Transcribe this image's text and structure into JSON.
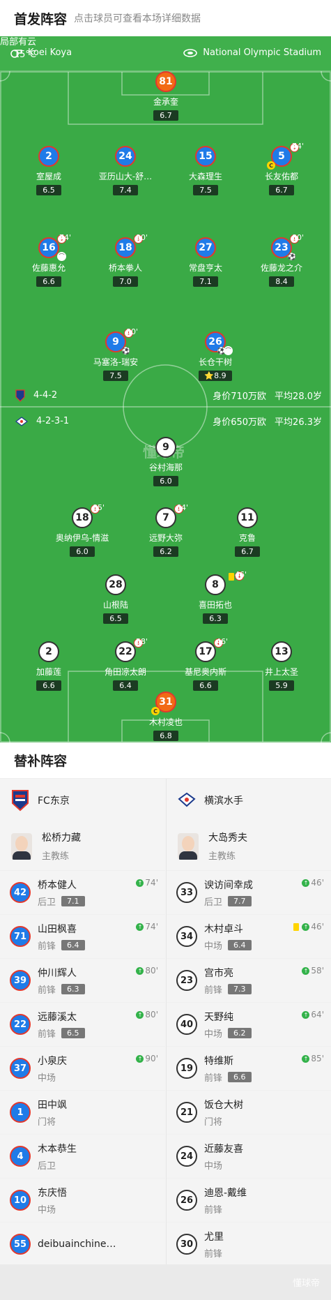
{
  "header": {
    "title": "首发阵容",
    "hint": "点击球员可查看本场详细数据"
  },
  "match": {
    "referee": "Koei Koya",
    "stadium": "National Olympic Stadium",
    "weather": "局部有云",
    "temperature": "15°C"
  },
  "home": {
    "formation": "4-4-2",
    "value": "身价710万欧",
    "age": "平均28.0岁",
    "players": [
      {
        "num": "81",
        "name": "金承奎",
        "rating": "6.7"
      },
      {
        "num": "2",
        "name": "室屋成",
        "rating": "6.5"
      },
      {
        "num": "24",
        "name": "亚历山大-舒…",
        "rating": "7.4"
      },
      {
        "num": "15",
        "name": "大森理生",
        "rating": "7.5"
      },
      {
        "num": "5",
        "name": "长友佑都",
        "rating": "6.7",
        "min": "74'"
      },
      {
        "num": "16",
        "name": "佐藤惠允",
        "rating": "6.6",
        "min": "74'"
      },
      {
        "num": "18",
        "name": "桥本拳人",
        "rating": "7.0",
        "min": "90'"
      },
      {
        "num": "27",
        "name": "常盘亨太",
        "rating": "7.1"
      },
      {
        "num": "23",
        "name": "佐藤龙之介",
        "rating": "8.4",
        "min": "80'"
      },
      {
        "num": "9",
        "name": "马塞洛-瑞安",
        "rating": "7.5",
        "min": "80'"
      },
      {
        "num": "26",
        "name": "长仓干树",
        "rating": "8.9"
      }
    ]
  },
  "away": {
    "formation": "4-2-3-1",
    "value": "身价650万欧",
    "age": "平均26.3岁",
    "players": [
      {
        "num": "9",
        "name": "谷村海那",
        "rating": "6.0"
      },
      {
        "num": "18",
        "name": "奥纳伊乌-情滋",
        "rating": "6.0",
        "min": "85'"
      },
      {
        "num": "7",
        "name": "远野大弥",
        "rating": "6.2",
        "min": "64'"
      },
      {
        "num": "11",
        "name": "克鲁",
        "rating": "6.7"
      },
      {
        "num": "28",
        "name": "山根陆",
        "rating": "6.5"
      },
      {
        "num": "8",
        "name": "喜田拓也",
        "rating": "6.3",
        "min": "46'"
      },
      {
        "num": "2",
        "name": "加藤莲",
        "rating": "6.6"
      },
      {
        "num": "22",
        "name": "角田凉太朗",
        "rating": "6.4",
        "min": "58'"
      },
      {
        "num": "17",
        "name": "基尼奥内斯",
        "rating": "6.6",
        "min": "46'"
      },
      {
        "num": "13",
        "name": "井上太圣",
        "rating": "5.9"
      },
      {
        "num": "31",
        "name": "木村凌也",
        "rating": "6.8"
      }
    ]
  },
  "watermark": "懂球帝",
  "subs": {
    "title": "替补阵容",
    "home": {
      "club": "FC东京",
      "coach": {
        "name": "松桥力藏",
        "role": "主教练"
      },
      "players": [
        {
          "num": "42",
          "name": "桥本健人",
          "pos": "后卫",
          "rating": "7.1",
          "in": "74'"
        },
        {
          "num": "71",
          "name": "山田枫喜",
          "pos": "前锋",
          "rating": "6.4",
          "in": "74'"
        },
        {
          "num": "39",
          "name": "仲川辉人",
          "pos": "前锋",
          "rating": "6.3",
          "in": "80'"
        },
        {
          "num": "22",
          "name": "远藤溪太",
          "pos": "前锋",
          "rating": "6.5",
          "in": "80'"
        },
        {
          "num": "37",
          "name": "小泉庆",
          "pos": "中场",
          "rating": "",
          "in": "90'"
        },
        {
          "num": "1",
          "name": "田中飒",
          "pos": "门将",
          "rating": "",
          "in": ""
        },
        {
          "num": "4",
          "name": "木本恭生",
          "pos": "后卫",
          "rating": "",
          "in": ""
        },
        {
          "num": "10",
          "name": "东庆悟",
          "pos": "中场",
          "rating": "",
          "in": ""
        },
        {
          "num": "55",
          "name": "deibuainchine…",
          "pos": "",
          "rating": "",
          "in": ""
        }
      ]
    },
    "away": {
      "club": "横滨水手",
      "coach": {
        "name": "大岛秀夫",
        "role": "主教练"
      },
      "players": [
        {
          "num": "33",
          "name": "谀访间幸成",
          "pos": "后卫",
          "rating": "7.7",
          "in": "46'"
        },
        {
          "num": "34",
          "name": "木村卓斗",
          "pos": "中场",
          "rating": "6.4",
          "in": "46'"
        },
        {
          "num": "23",
          "name": "宫市亮",
          "pos": "前锋",
          "rating": "7.3",
          "in": "58'"
        },
        {
          "num": "40",
          "name": "天野纯",
          "pos": "中场",
          "rating": "6.2",
          "in": "64'"
        },
        {
          "num": "19",
          "name": "特维斯",
          "pos": "前锋",
          "rating": "6.6",
          "in": "85'"
        },
        {
          "num": "21",
          "name": "饭仓大树",
          "pos": "门将",
          "rating": "",
          "in": ""
        },
        {
          "num": "24",
          "name": "近藤友喜",
          "pos": "中场",
          "rating": "",
          "in": ""
        },
        {
          "num": "26",
          "name": "迪恩-戴维",
          "pos": "前锋",
          "rating": "",
          "in": ""
        },
        {
          "num": "30",
          "name": "尤里",
          "pos": "前锋",
          "rating": "",
          "in": ""
        }
      ]
    }
  },
  "footer": {
    "logo": "懂球帝"
  }
}
